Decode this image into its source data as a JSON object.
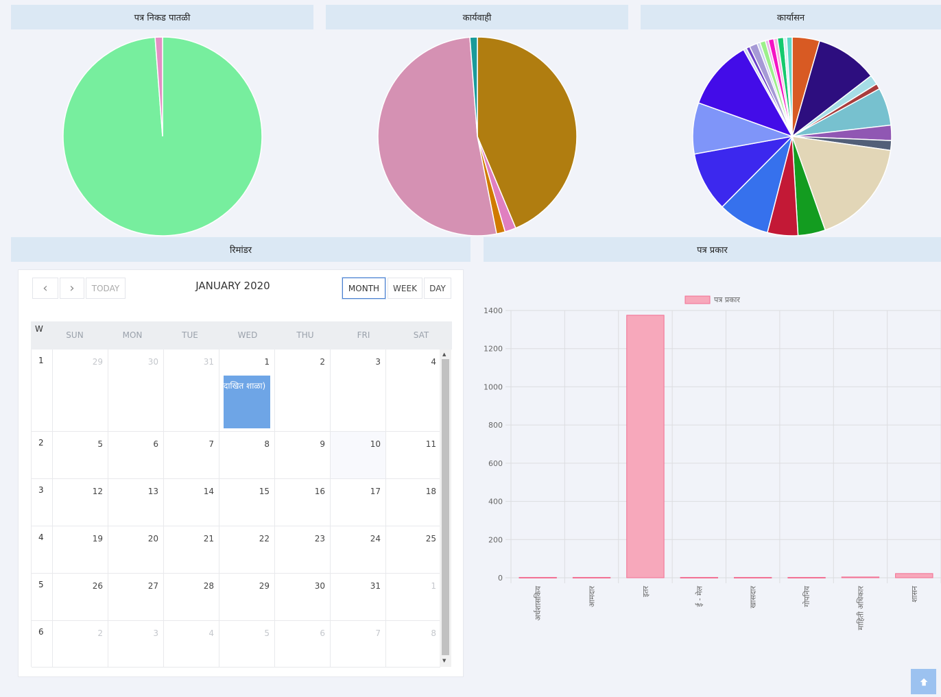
{
  "panels": {
    "pie1_title": "पत्र निकड पातळी",
    "pie2_title": "कार्यवाही",
    "pie3_title": "कार्यासन",
    "calendar_title": "रिमांडर",
    "bar_title": "पत्र प्रकार"
  },
  "chart_data": [
    {
      "type": "pie",
      "slices": [
        {
          "value": 98.8,
          "color": "#77ee9e"
        },
        {
          "value": 1.2,
          "color": "#e48ec4"
        }
      ]
    },
    {
      "type": "pie",
      "slices": [
        {
          "value": 43.7,
          "color": "#b07d10"
        },
        {
          "value": 1.8,
          "color": "#e07fc0"
        },
        {
          "value": 1.4,
          "color": "#d07a00"
        },
        {
          "value": 51.9,
          "color": "#d591b3"
        },
        {
          "value": 1.2,
          "color": "#1a9a9a"
        }
      ]
    },
    {
      "type": "pie",
      "slices": [
        {
          "value": 4.5,
          "color": "#d85a23"
        },
        {
          "value": 10.2,
          "color": "#2d0e7f"
        },
        {
          "value": 1.6,
          "color": "#a6dde6"
        },
        {
          "value": 0.9,
          "color": "#a83c3c"
        },
        {
          "value": 6.2,
          "color": "#77c1cf"
        },
        {
          "value": 2.5,
          "color": "#9057b3"
        },
        {
          "value": 1.6,
          "color": "#525f78"
        },
        {
          "value": 17.5,
          "color": "#e2d6b7"
        },
        {
          "value": 4.5,
          "color": "#139c20"
        },
        {
          "value": 5.0,
          "color": "#c31936"
        },
        {
          "value": 8.5,
          "color": "#3671ed"
        },
        {
          "value": 9.8,
          "color": "#3c28ee"
        },
        {
          "value": 8.4,
          "color": "#7f95f9"
        },
        {
          "value": 11.5,
          "color": "#430ce8"
        },
        {
          "value": 0.5,
          "color": "#cfd8f0"
        },
        {
          "value": 0.6,
          "color": "#6a3dc8"
        },
        {
          "value": 1.3,
          "color": "#a69ad6"
        },
        {
          "value": 0.5,
          "color": "#cbd2ee"
        },
        {
          "value": 0.9,
          "color": "#9cf08b"
        },
        {
          "value": 0.5,
          "color": "#e8b8ea"
        },
        {
          "value": 0.9,
          "color": "#f413c4"
        },
        {
          "value": 0.6,
          "color": "#f7b3e3"
        },
        {
          "value": 1.0,
          "color": "#15ca6e"
        },
        {
          "value": 0.5,
          "color": "#d4edf1"
        },
        {
          "value": 0.9,
          "color": "#5fd8c8"
        }
      ]
    },
    {
      "type": "bar",
      "categories": [
        "अर्धशासकिय",
        "आमदार",
        "इतर",
        "ई - मेल",
        "खासदार",
        "गोपनिय",
        "माहिती अधिकार",
        "शासन"
      ],
      "series": [
        {
          "name": "पत्र प्रकार",
          "values": [
            2,
            2,
            1375,
            2,
            2,
            2,
            4,
            22
          ],
          "color": "#f7a8bb"
        }
      ],
      "ylim": [
        0,
        1400
      ],
      "yticks": [
        0,
        200,
        400,
        600,
        800,
        1000,
        1200,
        1400
      ],
      "grid": true,
      "legend": "top"
    }
  ],
  "calendar": {
    "title": "JANUARY 2020",
    "today_label": "TODAY",
    "month_label": "MONTH",
    "week_label": "WEEK",
    "day_label": "DAY",
    "prev_icon": "‹",
    "next_icon": "›",
    "week_header": "W",
    "day_names": [
      "SUN",
      "MON",
      "TUE",
      "WED",
      "THU",
      "FRI",
      "SAT"
    ],
    "weeks": [
      {
        "num": "1",
        "days": [
          [
            "29",
            "other"
          ],
          [
            "30",
            "other"
          ],
          [
            "31",
            "other"
          ],
          [
            "1",
            ""
          ],
          [
            "2",
            ""
          ],
          [
            "3",
            ""
          ],
          [
            "4",
            ""
          ]
        ]
      },
      {
        "num": "2",
        "days": [
          [
            "5",
            ""
          ],
          [
            "6",
            ""
          ],
          [
            "7",
            ""
          ],
          [
            "8",
            ""
          ],
          [
            "9",
            ""
          ],
          [
            "10",
            "today"
          ],
          [
            "11",
            ""
          ]
        ]
      },
      {
        "num": "3",
        "days": [
          [
            "12",
            ""
          ],
          [
            "13",
            ""
          ],
          [
            "14",
            ""
          ],
          [
            "15",
            ""
          ],
          [
            "16",
            ""
          ],
          [
            "17",
            ""
          ],
          [
            "18",
            ""
          ]
        ]
      },
      {
        "num": "4",
        "days": [
          [
            "19",
            ""
          ],
          [
            "20",
            ""
          ],
          [
            "21",
            ""
          ],
          [
            "22",
            ""
          ],
          [
            "23",
            ""
          ],
          [
            "24",
            ""
          ],
          [
            "25",
            ""
          ]
        ]
      },
      {
        "num": "5",
        "days": [
          [
            "26",
            ""
          ],
          [
            "27",
            ""
          ],
          [
            "28",
            ""
          ],
          [
            "29",
            ""
          ],
          [
            "30",
            ""
          ],
          [
            "31",
            ""
          ],
          [
            "1",
            "other"
          ]
        ]
      },
      {
        "num": "6",
        "days": [
          [
            "2",
            "other"
          ],
          [
            "3",
            "other"
          ],
          [
            "4",
            "other"
          ],
          [
            "5",
            "other"
          ],
          [
            "6",
            "other"
          ],
          [
            "7",
            "other"
          ],
          [
            "8",
            "other"
          ]
        ]
      }
    ],
    "event_text": "दाखित शाळा)"
  },
  "icons": {
    "scroll_top": "arrow-up-icon"
  }
}
